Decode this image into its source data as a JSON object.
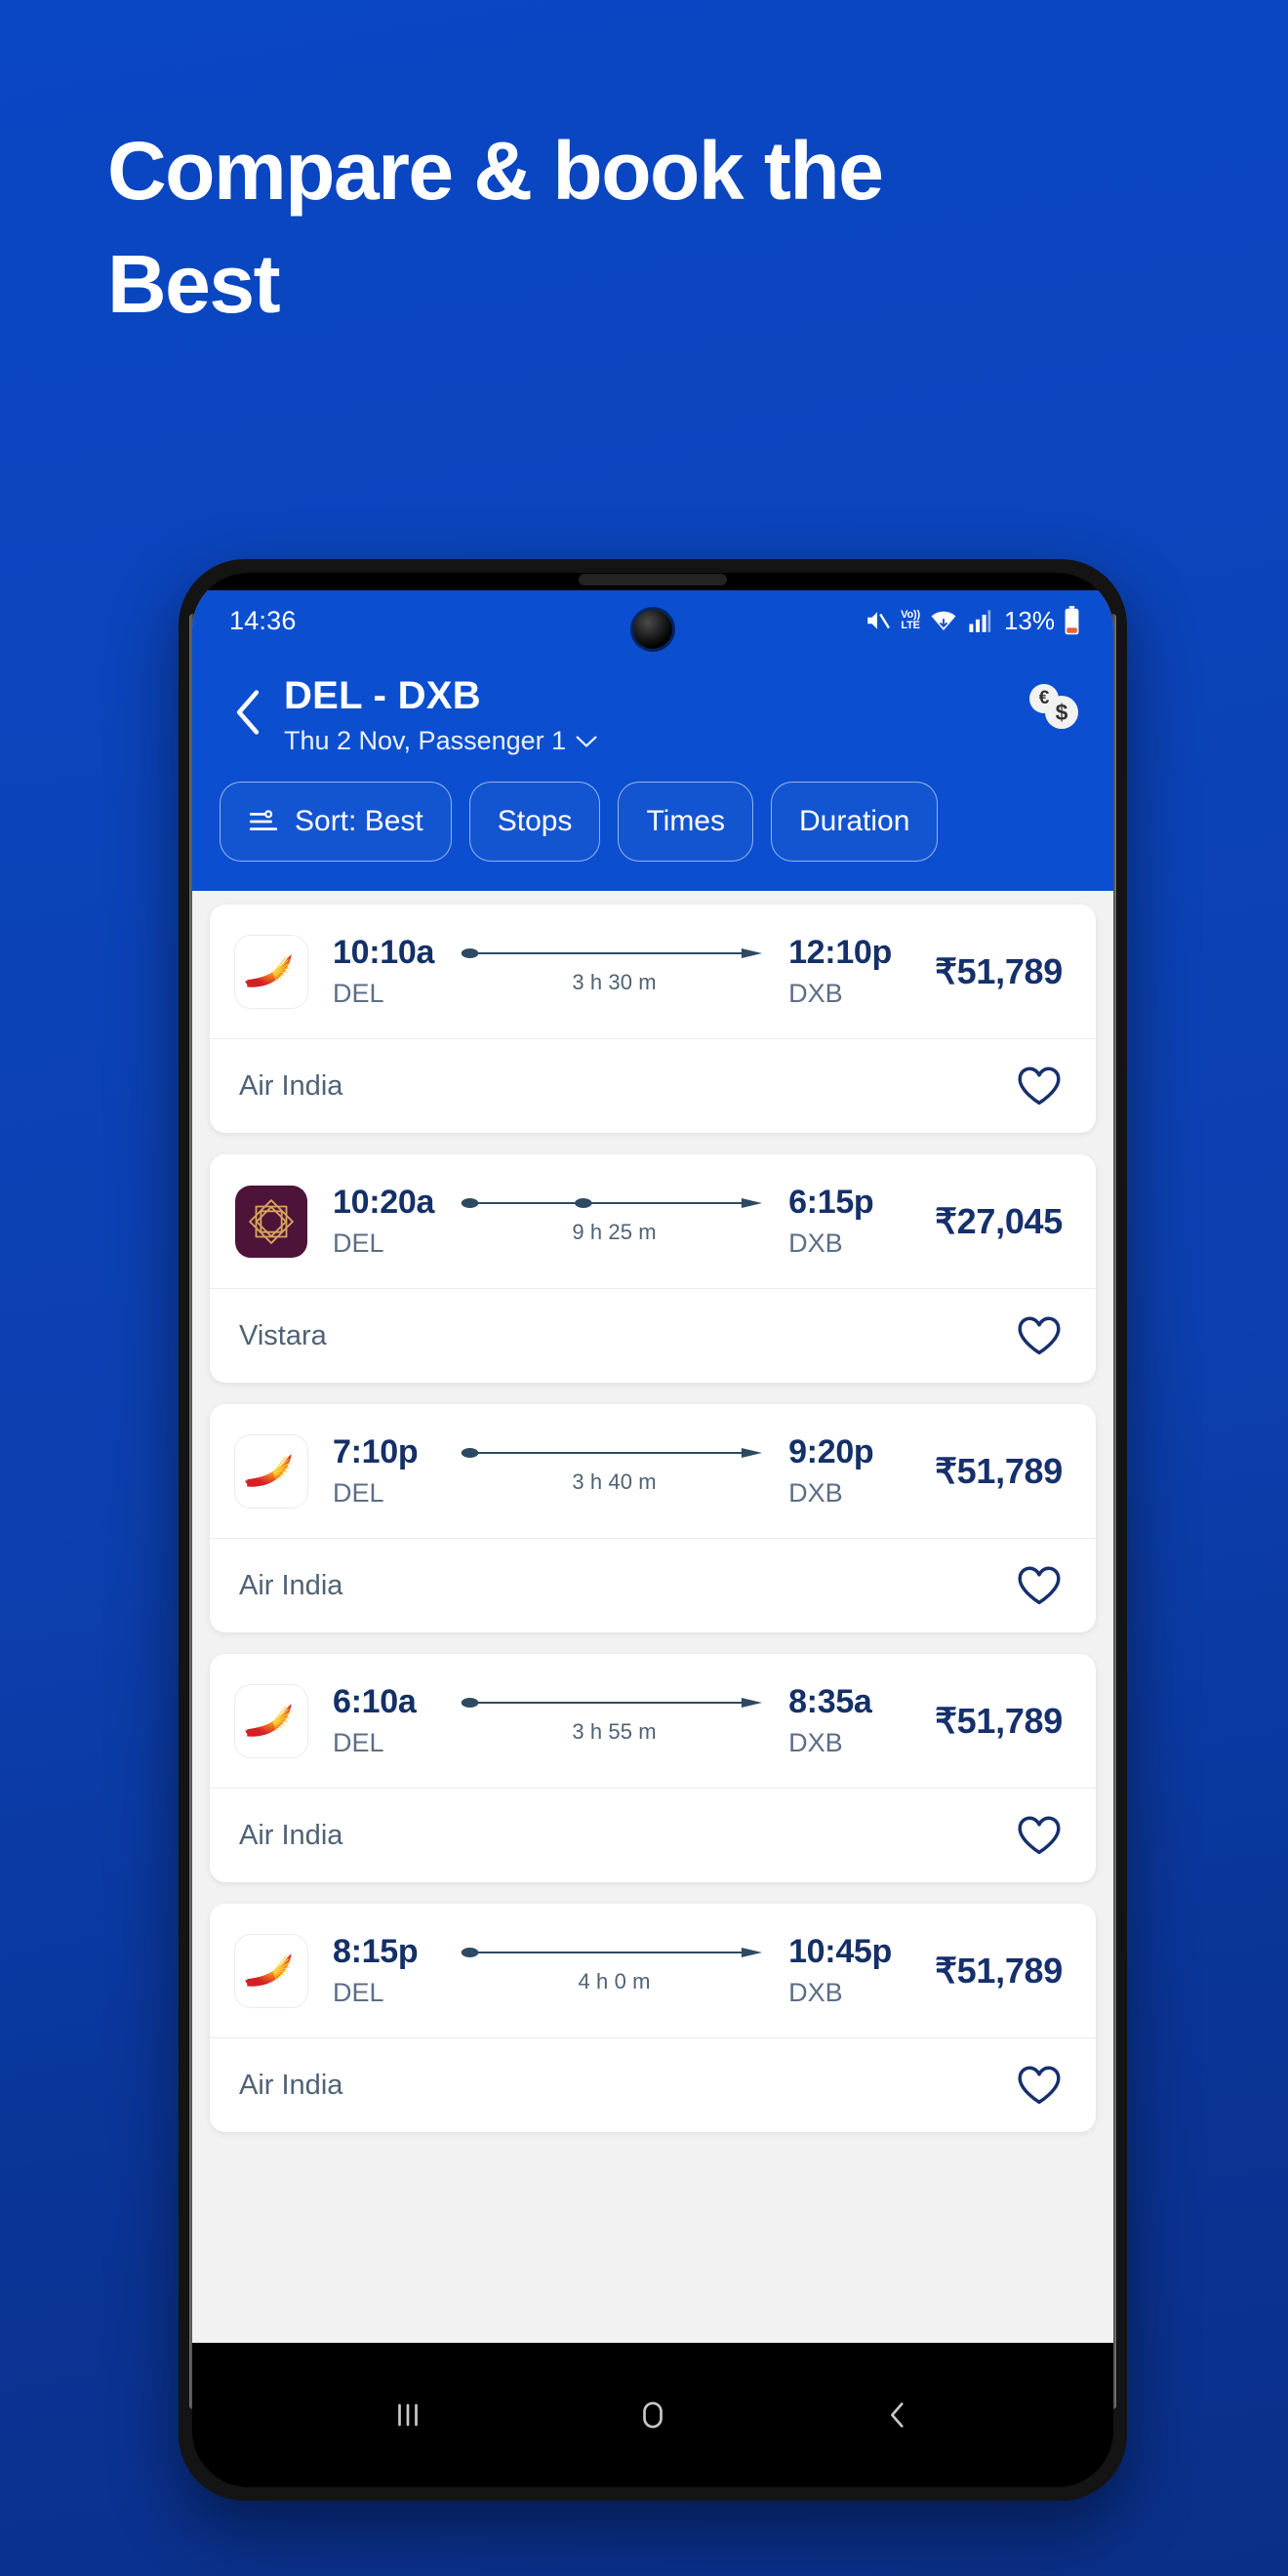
{
  "promo": {
    "headline_line1": "Compare & book the",
    "headline_line2": "Best",
    "background_color": "#0b44bc"
  },
  "statusbar": {
    "time": "14:36",
    "mute_icon": "mute-icon",
    "volte_top": "Vo))",
    "volte_bottom": "LTE",
    "wifi_icon": "wifi-icon",
    "signal_icon": "signal-bars-icon",
    "battery_percent": "13%",
    "battery_icon": "battery-low-icon"
  },
  "header": {
    "back_icon": "back-chevron-icon",
    "title": "DEL - DXB",
    "subtitle": "Thu 2 Nov, Passenger 1",
    "subtitle_chevron": "chevron-down-icon",
    "currency_icon": "currency-coins-icon",
    "coin_euro": "€",
    "coin_dollar": "$",
    "accent_color": "#0b4fd0"
  },
  "filters": [
    {
      "label": "Sort: Best",
      "icon": "sort-icon",
      "has_icon": true
    },
    {
      "label": "Stops",
      "icon": "",
      "has_icon": false
    },
    {
      "label": "Times",
      "icon": "",
      "has_icon": false
    },
    {
      "label": "Duration",
      "icon": "",
      "has_icon": false
    }
  ],
  "flights": [
    {
      "airline": "Air India",
      "logo": "air-india-logo",
      "depart_time": "10:10a",
      "depart_code": "DEL",
      "arrive_time": "12:10p",
      "arrive_code": "DXB",
      "duration": "3 h 30 m",
      "stops": 0,
      "price": "₹51,789",
      "favorite_icon": "heart-outline-icon"
    },
    {
      "airline": "Vistara",
      "logo": "vistara-logo",
      "depart_time": "10:20a",
      "depart_code": "DEL",
      "arrive_time": "6:15p",
      "arrive_code": "DXB",
      "duration": "9 h 25 m",
      "stops": 1,
      "price": "₹27,045",
      "favorite_icon": "heart-outline-icon"
    },
    {
      "airline": "Air India",
      "logo": "air-india-logo",
      "depart_time": "7:10p",
      "depart_code": "DEL",
      "arrive_time": "9:20p",
      "arrive_code": "DXB",
      "duration": "3 h 40 m",
      "stops": 0,
      "price": "₹51,789",
      "favorite_icon": "heart-outline-icon"
    },
    {
      "airline": "Air India",
      "logo": "air-india-logo",
      "depart_time": "6:10a",
      "depart_code": "DEL",
      "arrive_time": "8:35a",
      "arrive_code": "DXB",
      "duration": "3 h 55 m",
      "stops": 0,
      "price": "₹51,789",
      "favorite_icon": "heart-outline-icon"
    },
    {
      "airline": "Air India",
      "logo": "air-india-logo",
      "depart_time": "8:15p",
      "depart_code": "DEL",
      "arrive_time": "10:45p",
      "arrive_code": "DXB",
      "duration": "4 h 0 m",
      "stops": 0,
      "price": "₹51,789",
      "favorite_icon": "heart-outline-icon"
    }
  ],
  "navbar": {
    "recents_icon": "recents-icon",
    "home_icon": "home-icon",
    "back_icon": "back-icon"
  }
}
